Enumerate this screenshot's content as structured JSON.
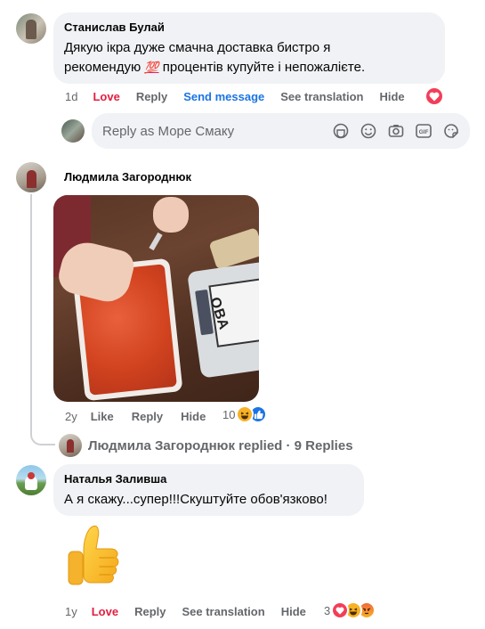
{
  "comments": [
    {
      "author": "Станислав Булай",
      "text_line1": "Дякую ікра дуже смачна доставка бистро я",
      "text_line2_a": "рекомендую ",
      "text_line2_emoji": "💯",
      "text_line2_b": " процентів купуйте і непожалієте.",
      "time": "1d",
      "actions": [
        "Love",
        "Reply",
        "Send message",
        "See translation",
        "Hide"
      ]
    },
    {
      "author": "Людмила Загороднюк",
      "photo_label": "ОВА",
      "time": "2y",
      "actions": [
        "Like",
        "Reply",
        "Hide"
      ],
      "reaction_count": "10",
      "replies_link": "Людмила Загороднюк replied · 9 Replies"
    },
    {
      "author": "Наталья Заливша",
      "text": "А я скажу...супер!!!Скуштуйте обов'язково!",
      "time": "1y",
      "actions": [
        "Love",
        "Reply",
        "See translation",
        "Hide"
      ],
      "reaction_count": "3"
    }
  ],
  "reply_box": {
    "placeholder": "Reply as Море Смаку",
    "tools": [
      "avatar-sticker-icon",
      "emoji-icon",
      "camera-icon",
      "gif-icon",
      "sticker-icon"
    ]
  },
  "colors": {
    "love": "#e41e3f",
    "link_blue": "#1b74e4",
    "meta_gray": "#65676b",
    "bubble": "#f0f2f5"
  }
}
